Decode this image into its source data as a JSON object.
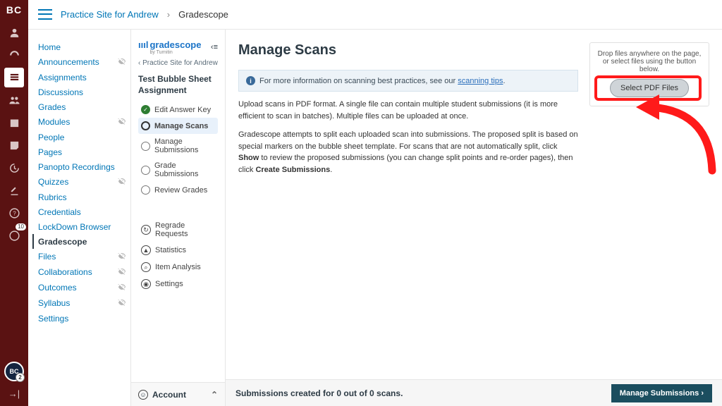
{
  "rail": {
    "logo": "BC",
    "badge_count": "10",
    "avatar_initials": "BC",
    "avatar_badge": "2"
  },
  "breadcrumb": {
    "course": "Practice Site for Andrew",
    "sep": "›",
    "page": "Gradescope"
  },
  "course_nav": {
    "items": [
      {
        "label": "Home",
        "hidden": false
      },
      {
        "label": "Announcements",
        "hidden": true
      },
      {
        "label": "Assignments",
        "hidden": false
      },
      {
        "label": "Discussions",
        "hidden": false
      },
      {
        "label": "Grades",
        "hidden": false
      },
      {
        "label": "Modules",
        "hidden": true
      },
      {
        "label": "People",
        "hidden": false
      },
      {
        "label": "Pages",
        "hidden": false
      },
      {
        "label": "Panopto Recordings",
        "hidden": false
      },
      {
        "label": "Quizzes",
        "hidden": true
      },
      {
        "label": "Rubrics",
        "hidden": false
      },
      {
        "label": "Credentials",
        "hidden": false
      },
      {
        "label": "LockDown Browser",
        "hidden": false
      },
      {
        "label": "Gradescope",
        "hidden": false,
        "current": true
      },
      {
        "label": "Files",
        "hidden": true
      },
      {
        "label": "Collaborations",
        "hidden": true
      },
      {
        "label": "Outcomes",
        "hidden": true
      },
      {
        "label": "Syllabus",
        "hidden": true
      },
      {
        "label": "Settings",
        "hidden": false
      }
    ]
  },
  "gs": {
    "brand_prefix": "ıııl ",
    "brand": "gradescope",
    "brand_sub": "by Turnitin",
    "back": "‹ Practice Site for Andrew",
    "assignment": "Test Bubble Sheet Assignment",
    "steps": [
      {
        "label": "Edit Answer Key",
        "state": "done"
      },
      {
        "label": "Manage Scans",
        "state": "active"
      },
      {
        "label": "Manage Submissions",
        "state": "todo"
      },
      {
        "label": "Grade Submissions",
        "state": "todo"
      },
      {
        "label": "Review Grades",
        "state": "todo"
      }
    ],
    "tools": [
      {
        "icon": "↻",
        "label": "Regrade Requests"
      },
      {
        "icon": "▲",
        "label": "Statistics"
      },
      {
        "icon": "⌕",
        "label": "Item Analysis"
      },
      {
        "icon": "◉",
        "label": "Settings"
      }
    ],
    "footer": {
      "icon": "☺",
      "label": "Account",
      "chev": "⌃"
    }
  },
  "page": {
    "title": "Manage Scans",
    "info_pre": "For more information on scanning best practices, see our ",
    "info_link": "scanning tips",
    "info_post": ".",
    "p1": "Upload scans in PDF format. A single file can contain multiple student submissions (it is more efficient to scan in batches). Multiple files can be uploaded at once.",
    "p2_pre": "Gradescope attempts to split each uploaded scan into submissions. The proposed split is based on special markers on the bubble sheet template. For scans that are not automatically split, click ",
    "p2_b1": "Show",
    "p2_mid": " to review the proposed submissions (you can change split points and re-order pages), then click ",
    "p2_b2": "Create Submissions",
    "p2_post": ".",
    "drop_text": "Drop files anywhere on the page, or select files using the button below.",
    "drop_btn": "Select PDF Files"
  },
  "footer_bar": {
    "status": "Submissions created for 0 out of 0 scans.",
    "btn": "Manage Submissions ›"
  }
}
